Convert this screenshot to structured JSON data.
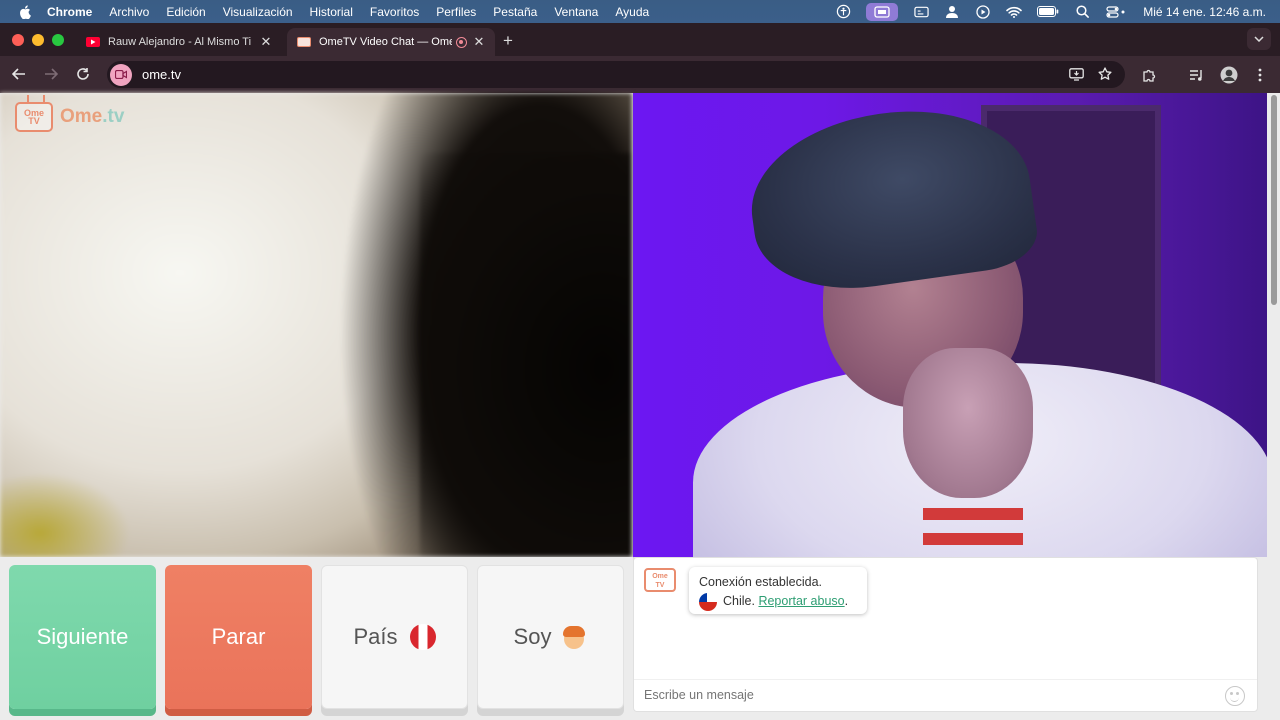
{
  "menubar": {
    "app": "Chrome",
    "items": [
      "Archivo",
      "Edición",
      "Visualización",
      "Historial",
      "Favoritos",
      "Perfiles",
      "Pestaña",
      "Ventana",
      "Ayuda"
    ],
    "clock": "Mié 14 ene.  12:46 a.m."
  },
  "tabs": [
    {
      "title": "Rauw Alejandro - Al Mismo Ti",
      "favicon": "youtube-icon",
      "active": false
    },
    {
      "title": "OmeTV Video Chat — Ome",
      "favicon": "ometv-icon",
      "active": true
    }
  ],
  "toolbar": {
    "url": "ome.tv"
  },
  "page": {
    "logo": {
      "badge_top": "Ome",
      "badge_bottom": "TV",
      "brand_main": "Ome",
      "brand_tld": ".tv"
    },
    "buttons": {
      "next": "Siguiente",
      "stop": "Parar",
      "country": "País",
      "iam": "Soy"
    },
    "chat": {
      "avatar_top": "Ome",
      "avatar_bottom": "TV",
      "status": "Conexión establecida.",
      "country": "Chile.",
      "report": "Reportar abuso",
      "report_after": ".",
      "placeholder": "Escribe un mensaje"
    }
  },
  "colors": {
    "next": "#72d3a4",
    "stop": "#ec775d",
    "link": "#2e9e73",
    "brand_orange": "#e98c6e"
  }
}
